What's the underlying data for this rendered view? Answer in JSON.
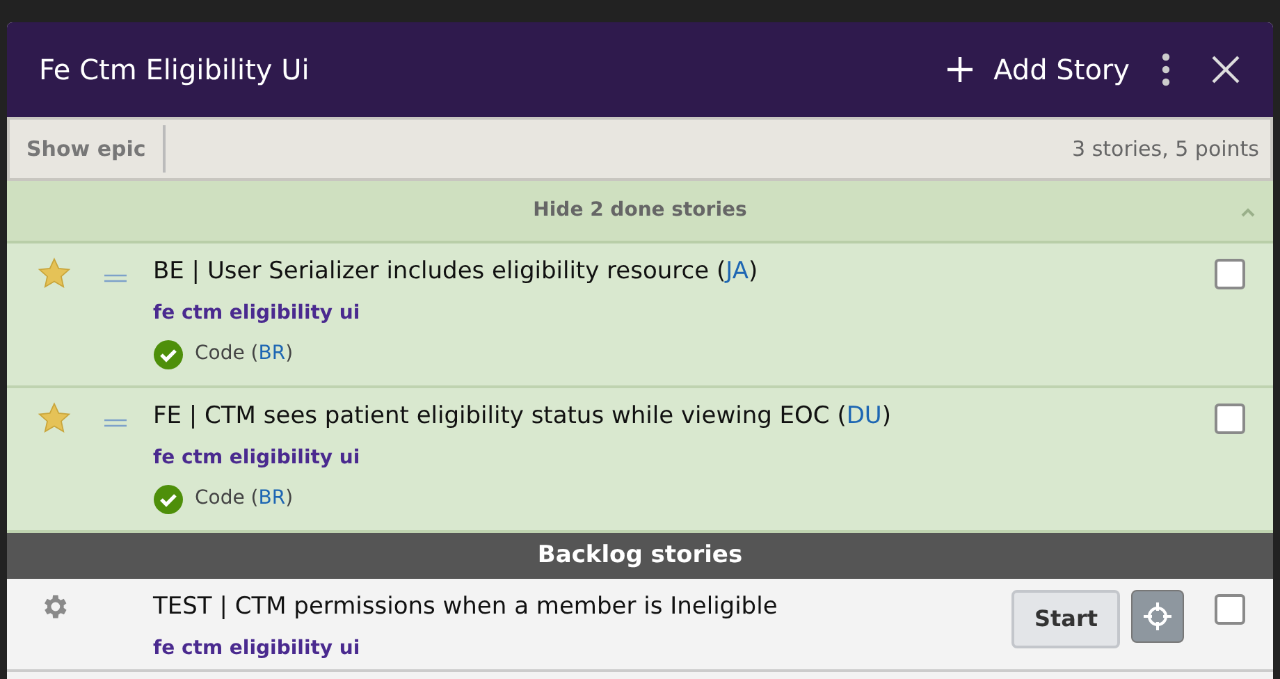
{
  "header": {
    "title": "Fe Ctm Eligibility Ui",
    "add_label": "Add Story"
  },
  "toolbar": {
    "show_epic": "Show epic",
    "summary": "3 stories, 5 points"
  },
  "done_section": {
    "label": "Hide 2 done stories",
    "expanded": true
  },
  "done_stories": [
    {
      "kind": "done",
      "title": [
        {
          "kind": "text",
          "text": "BE | User Serializer includes eligibility resource ("
        },
        {
          "kind": "owner",
          "text": "JA"
        },
        {
          "kind": "text",
          "text": ")"
        }
      ],
      "label": "fe ctm eligibility ui",
      "tasks": [
        {
          "done": true,
          "parts": [
            {
              "kind": "text",
              "text": "Code ("
            },
            {
              "kind": "owner",
              "text": "BR"
            },
            {
              "kind": "text",
              "text": ")"
            }
          ]
        }
      ],
      "checked": false
    },
    {
      "kind": "done",
      "title": [
        {
          "kind": "text",
          "text": "FE | CTM sees patient eligibility status while viewing EOC ("
        },
        {
          "kind": "owner",
          "text": "DU"
        },
        {
          "kind": "text",
          "text": ")"
        }
      ],
      "label": "fe ctm eligibility ui",
      "tasks": [
        {
          "done": true,
          "parts": [
            {
              "kind": "text",
              "text": "Code ("
            },
            {
              "kind": "owner",
              "text": "BR"
            },
            {
              "kind": "text",
              "text": ")"
            }
          ]
        }
      ],
      "checked": false
    }
  ],
  "backlog_section": {
    "label": "Backlog stories"
  },
  "backlog_stories": [
    {
      "kind": "chore",
      "title": [
        {
          "kind": "text",
          "text": "TEST | CTM permissions when a member is Ineligible"
        }
      ],
      "label": "fe ctm eligibility ui",
      "action": "Start",
      "checked": false
    }
  ]
}
